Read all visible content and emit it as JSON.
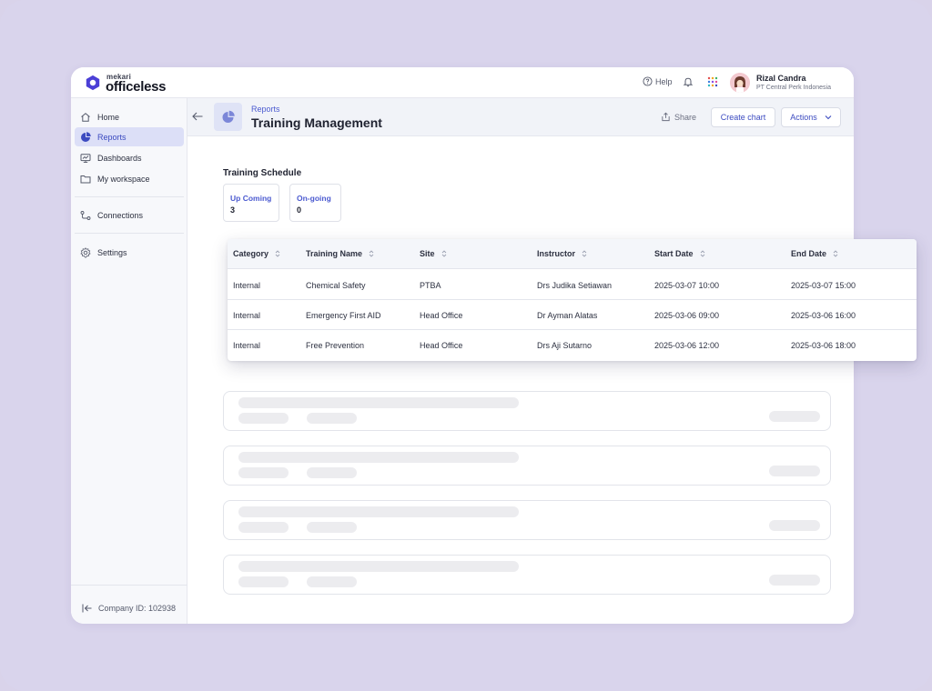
{
  "brand": {
    "small": "mekari",
    "big": "officeless",
    "accent": "#4b3fd6"
  },
  "topbar": {
    "help_label": "Help",
    "user_name": "Rizal Candra",
    "user_org": "PT Central Perk Indonesia"
  },
  "sidebar": {
    "items": [
      {
        "label": "Home",
        "icon": "home-icon"
      },
      {
        "label": "Reports",
        "icon": "pie-chart-icon"
      },
      {
        "label": "Dashboards",
        "icon": "monitor-icon"
      },
      {
        "label": "My workspace",
        "icon": "folder-icon"
      },
      {
        "label": "Connections",
        "icon": "connections-icon"
      },
      {
        "label": "Settings",
        "icon": "gear-icon"
      }
    ],
    "company_id": "Company ID: 102938"
  },
  "header": {
    "breadcrumb": "Reports",
    "title": "Training Management",
    "share_label": "Share",
    "create_chart_label": "Create chart",
    "actions_label": "Actions"
  },
  "schedule": {
    "title": "Training Schedule",
    "stats": [
      {
        "label": "Up Coming",
        "value": "3"
      },
      {
        "label": "On-going",
        "value": "0"
      }
    ]
  },
  "table": {
    "columns": [
      "Category",
      "Training Name",
      "Site",
      "Instructor",
      "Start Date",
      "End Date"
    ],
    "rows": [
      [
        "Internal",
        "Chemical Safety",
        "PTBA",
        "Drs Judika Setiawan",
        "2025-03-07 10:00",
        "2025-03-07 15:00"
      ],
      [
        "Internal",
        "Emergency First AID",
        "Head Office",
        "Dr Ayman Alatas",
        "2025-03-06 09:00",
        "2025-03-06 16:00"
      ],
      [
        "Internal",
        "Free Prevention",
        "Head Office",
        "Drs Aji Sutarno",
        "2025-03-06 12:00",
        "2025-03-06 18:00"
      ]
    ]
  },
  "colors": {
    "active_nav_bg": "#dcdff7",
    "link": "#4b5ad0",
    "page_bg": "#d9d3ea"
  }
}
